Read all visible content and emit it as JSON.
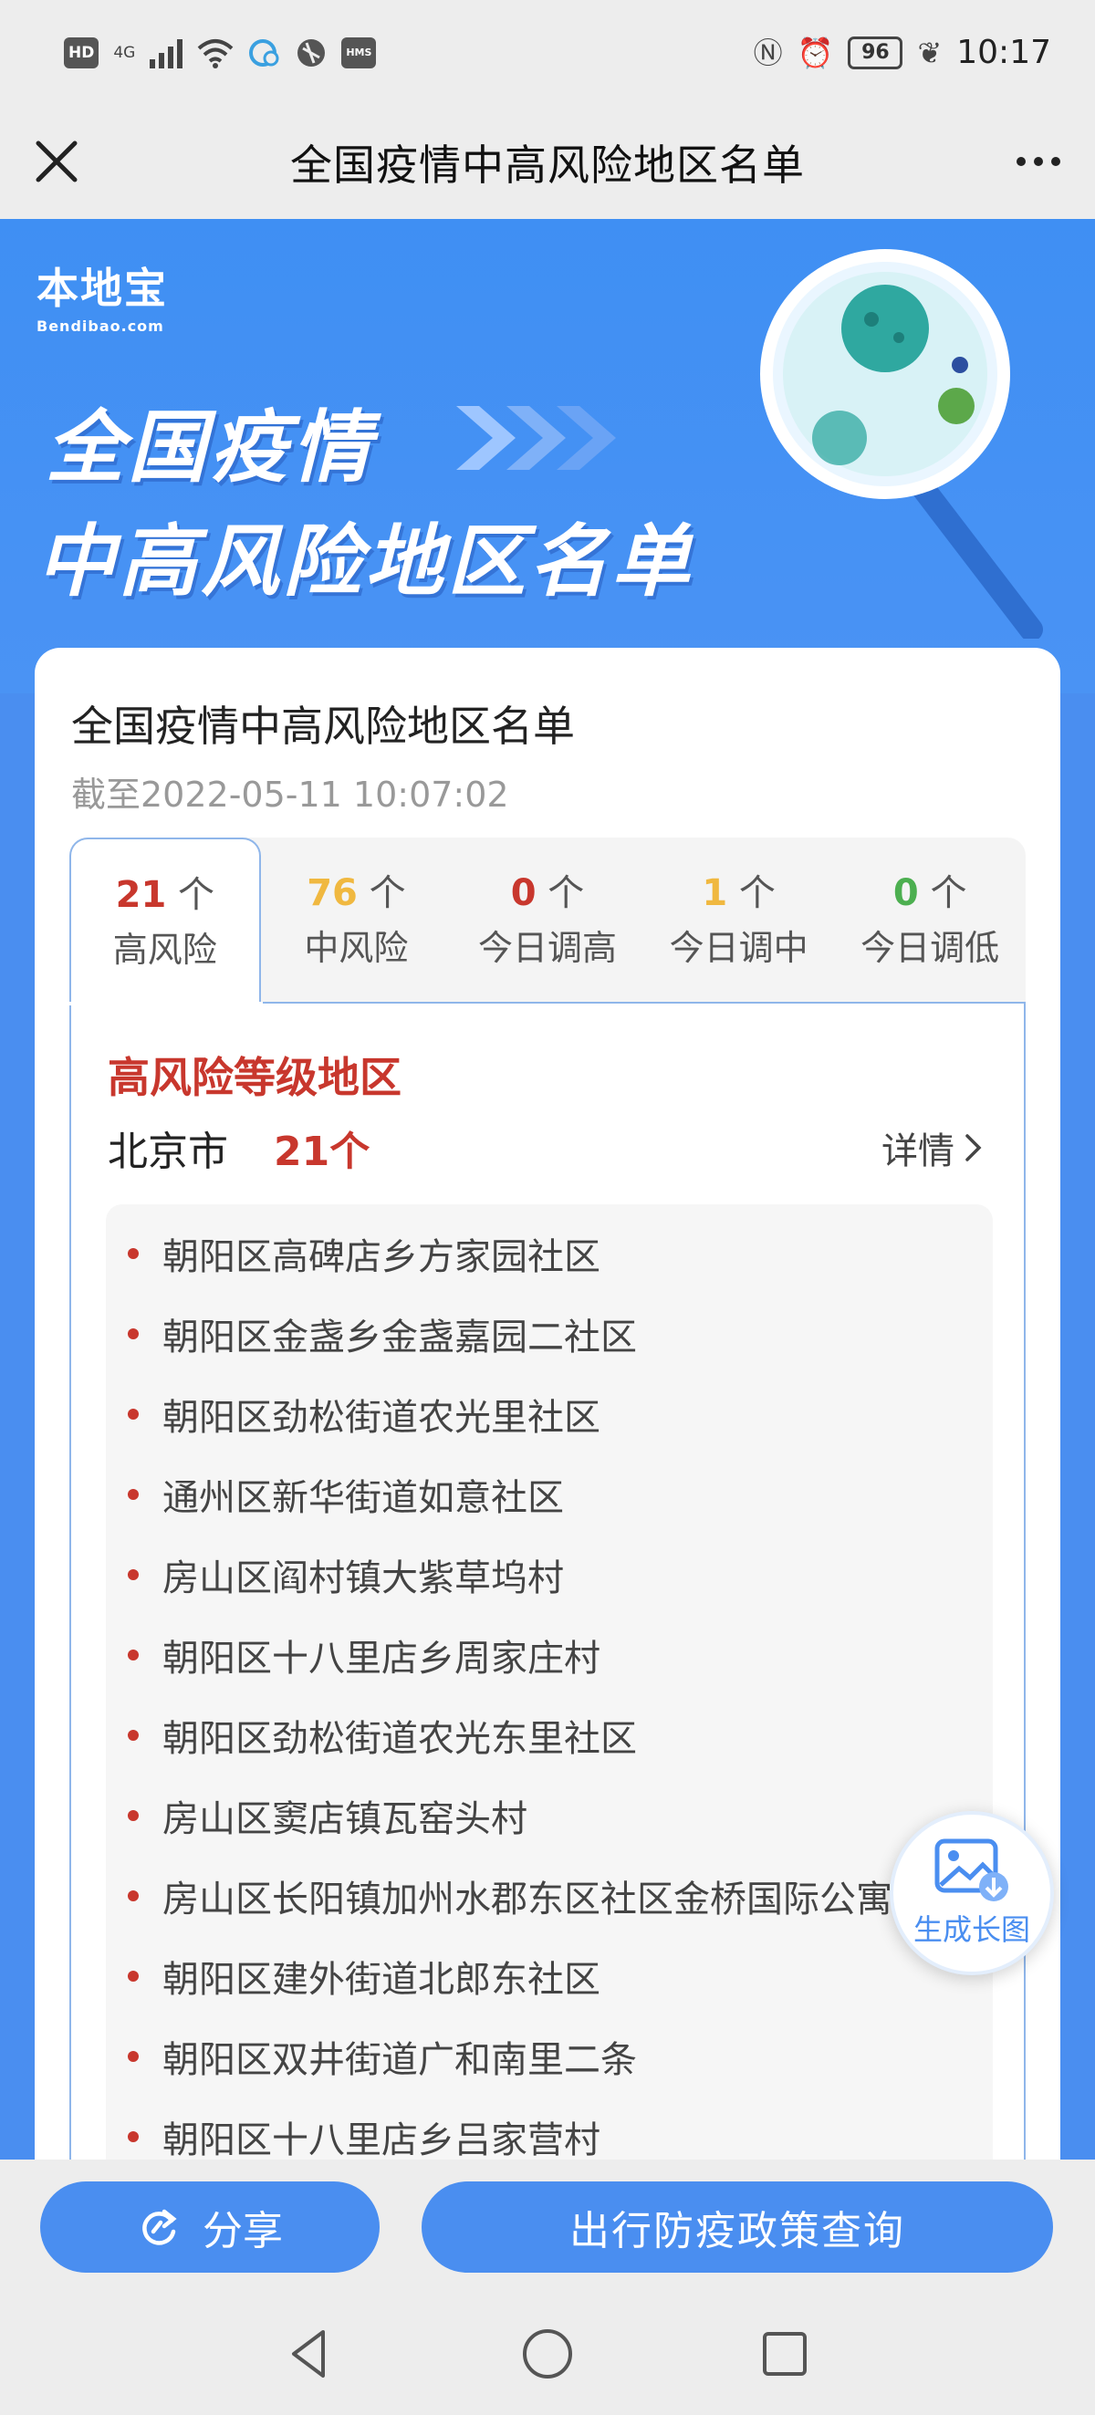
{
  "status_bar": {
    "hd": "HD",
    "network": "4G",
    "hms": "HMS",
    "battery": "96",
    "time": "10:17"
  },
  "header": {
    "title": "全国疫情中高风险地区名单"
  },
  "banner": {
    "logo_text": "本地宝",
    "logo_sub": "Bendibao.com",
    "line1": "全国疫情",
    "line2": "中高风险地区名单"
  },
  "card": {
    "title": "全国疫情中高风险地区名单",
    "updated": "截至2022-05-11 10:07:02",
    "tabs": [
      {
        "count": "21",
        "unit": " 个",
        "label": "高风险",
        "color": "#c8372d"
      },
      {
        "count": "76",
        "unit": " 个",
        "label": "中风险",
        "color": "#f0b840"
      },
      {
        "count": "0",
        "unit": " 个",
        "label": "今日调高",
        "color": "#c8372d"
      },
      {
        "count": "1",
        "unit": " 个",
        "label": "今日调中",
        "color": "#f0b840"
      },
      {
        "count": "0",
        "unit": " 个",
        "label": "今日调低",
        "color": "#4caf50"
      }
    ],
    "level_title": "高风险等级地区",
    "city": "北京市",
    "city_count": "21个",
    "detail_label": "详情",
    "areas": [
      "朝阳区高碑店乡方家园社区",
      "朝阳区金盏乡金盏嘉园二社区",
      "朝阳区劲松街道农光里社区",
      "通州区新华街道如意社区",
      "房山区阎村镇大紫草坞村",
      "朝阳区十八里店乡周家庄村",
      "朝阳区劲松街道农光东里社区",
      "房山区窦店镇瓦窑头村",
      "房山区长阳镇加州水郡东区社区金桥国际公寓",
      "朝阳区建外街道北郎东社区",
      "朝阳区双井街道广和南里二条",
      "朝阳区十八里店乡吕家营村"
    ]
  },
  "float_button": {
    "label": "生成长图"
  },
  "actions": {
    "share_label": "分享",
    "policy_label": "出行防疫政策查询"
  },
  "colors": {
    "accent": "#4a8ef0",
    "high_risk": "#c8372d",
    "medium_risk": "#f0b840",
    "low_risk": "#4caf50"
  }
}
